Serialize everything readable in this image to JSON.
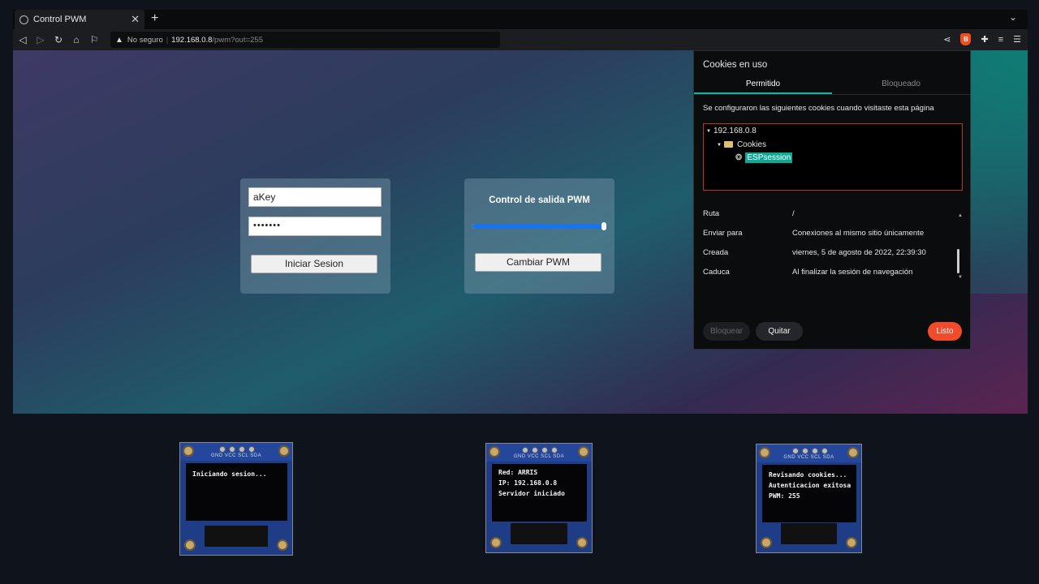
{
  "browser": {
    "tab_title": "Control PWM",
    "tab_close": "✕",
    "new_tab": "+",
    "tab_menu": "⌄",
    "url_warning": "No seguro",
    "url_separator": "|",
    "url_host": "192.168.0.8",
    "url_path": "/pwm?out=255",
    "brave_icon_glyph": "B"
  },
  "login_form": {
    "username_value": "aKey",
    "password_value": "•••••••",
    "login_button": "Iniciar Sesion"
  },
  "pwm_form": {
    "title": "Control de salida PWM",
    "slider_value": 255,
    "slider_max": 255,
    "change_button": "Cambiar PWM"
  },
  "cookies_panel": {
    "title": "Cookies en uso",
    "tabs": [
      "Permitido",
      "Bloqueado"
    ],
    "description": "Se configuraron las siguientes cookies cuando visitaste esta página",
    "tree": {
      "host": "192.168.0.8",
      "folder": "Cookies",
      "cookie": "ESPsession"
    },
    "details": [
      {
        "label": "Ruta",
        "value": "/"
      },
      {
        "label": "Enviar para",
        "value": "Conexiones al mismo sitio únicamente"
      },
      {
        "label": "Creada",
        "value": "viernes, 5 de agosto de 2022, 22:39:30"
      },
      {
        "label": "Caduca",
        "value": "Al finalizar la sesión de navegación"
      }
    ],
    "buttons": {
      "block": "Bloquear",
      "remove": "Quitar",
      "done": "Listo"
    }
  },
  "oled_displays": [
    {
      "pins": "GND VCC SCL SDA",
      "lines": [
        "Iniciando sesion..."
      ]
    },
    {
      "pins": "GND VCC SCL SDA",
      "lines": [
        "Red: ARRIS",
        "IP: 192.168.0.8",
        "Servidor iniciado"
      ]
    },
    {
      "pins": "GND VCC SCL SDA",
      "lines": [
        "Revisando cookies...",
        "Autenticacion exitosa",
        "PWM: 255"
      ]
    }
  ],
  "colors": {
    "accent": "#10a794",
    "done_button": "#f24b2b",
    "slider_fill": "#1a73e8"
  }
}
